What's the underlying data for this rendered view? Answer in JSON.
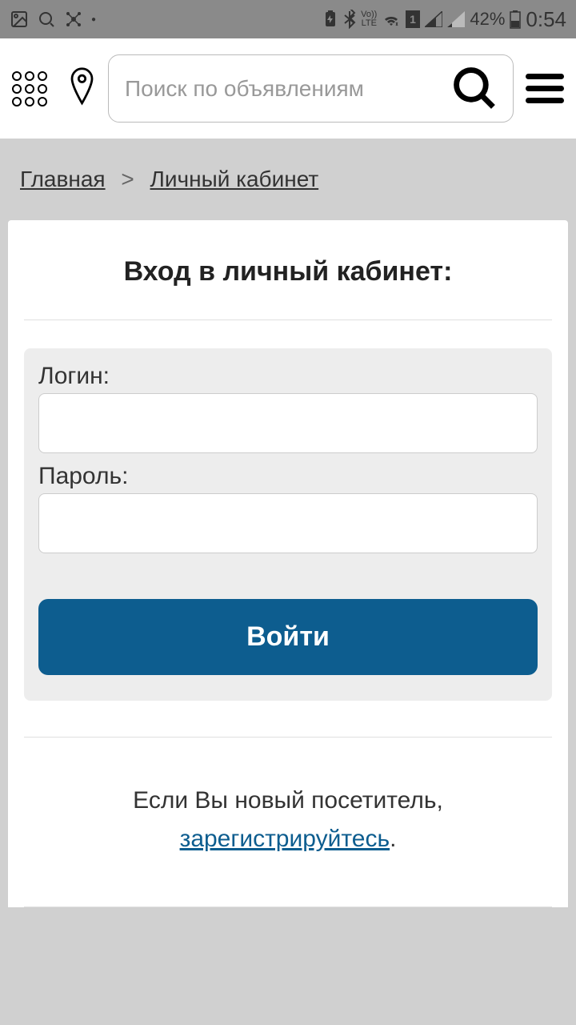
{
  "status_bar": {
    "battery_pct": "42%",
    "time": "0:54",
    "volte": "Vo))\nLTE"
  },
  "header": {
    "search_placeholder": "Поиск по объявлениям"
  },
  "breadcrumb": {
    "home": "Главная",
    "separator": ">",
    "current": "Личный кабинет"
  },
  "login": {
    "title": "Вход в личный кабинет:",
    "login_label": "Логин:",
    "password_label": "Пароль:",
    "submit_label": "Войти"
  },
  "register": {
    "prompt": "Если Вы новый посетитель,",
    "link_text": "зарегистрируйтесь",
    "suffix": "."
  }
}
